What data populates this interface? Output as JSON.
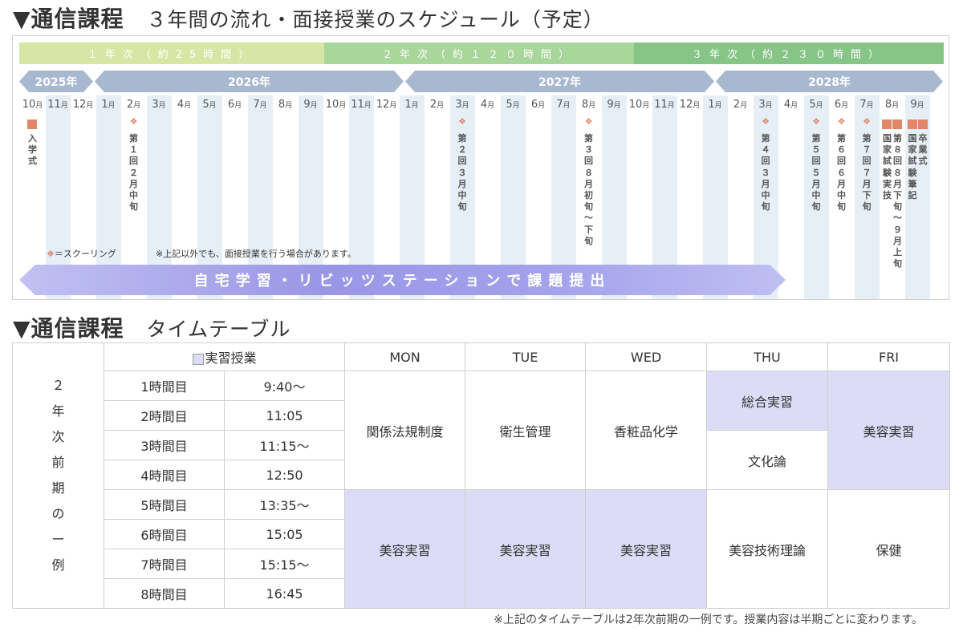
{
  "schedule_title": {
    "main": "▼通信課程",
    "sub": "３年間の流れ・面接授業のスケジュール（予定）"
  },
  "year_bars": [
    {
      "label": "１年次（約25時間）",
      "color": "#d7e6a4"
    },
    {
      "label": "２年次（約１２０時間）",
      "color": "#a9d69a"
    },
    {
      "label": "３年次（約２３０時間）",
      "color": "#86c585"
    }
  ],
  "calendar_years": [
    "2025年",
    "2026年",
    "2027年",
    "2028年"
  ],
  "months": [
    "10月",
    "11月",
    "12月",
    "1月",
    "2月",
    "3月",
    "4月",
    "5月",
    "6月",
    "7月",
    "8月",
    "9月",
    "10月",
    "11月",
    "12月",
    "1月",
    "2月",
    "3月",
    "4月",
    "5月",
    "6月",
    "7月",
    "8月",
    "9月",
    "10月",
    "11月",
    "12月",
    "1月",
    "2月",
    "3月",
    "4月",
    "5月",
    "6月",
    "7月",
    "8月",
    "9月"
  ],
  "events": [
    {
      "text": "入学式",
      "col": 0,
      "type": "square"
    },
    {
      "text": "第１回２月中旬",
      "col": 4,
      "type": "schooling"
    },
    {
      "text": "第２回３月中旬",
      "col": 17,
      "type": "schooling"
    },
    {
      "text": "第３回８月初旬〜下旬",
      "col": 22,
      "type": "schooling"
    },
    {
      "text": "第４回３月中旬",
      "col": 29,
      "type": "schooling"
    },
    {
      "text": "第５回５月中旬",
      "col": 31,
      "type": "schooling"
    },
    {
      "text": "第６回６月中旬",
      "col": 32,
      "type": "schooling"
    },
    {
      "text": "第７回７月下旬",
      "col": 33,
      "type": "schooling"
    },
    {
      "text": "国家試験実技",
      "col": 34,
      "type": "square",
      "shift": -6
    },
    {
      "text": "第８回８月下旬〜９月上旬",
      "col": 34,
      "type": "square",
      "shift": 7
    },
    {
      "text": "国家試験筆記",
      "col": 35,
      "type": "square",
      "shift": -6
    },
    {
      "text": "卒業式",
      "col": 35,
      "type": "square",
      "shift": 7
    }
  ],
  "legend_schooling": "＝スクーリング",
  "note_other": "※上記以外でも、面接授業を行う場合があります。",
  "study_band": "自宅学習・リビッツステーションで課題提出",
  "timetable_title": {
    "main": "▼通信課程",
    "sub": "タイムテーブル"
  },
  "timetable": {
    "legend": "実習授業",
    "side_label": [
      "２",
      "年",
      "次",
      "前",
      "期",
      "の",
      "ー",
      "例"
    ],
    "days": [
      "MON",
      "TUE",
      "WED",
      "THU",
      "FRI"
    ],
    "periods": [
      "1時間目",
      "2時間目",
      "3時間目",
      "4時間目",
      "5時間目",
      "6時間目",
      "7時間目",
      "8時間目"
    ],
    "times": [
      "9:40〜",
      "11:05",
      "11:15〜",
      "12:50",
      "13:35〜",
      "15:05",
      "15:15〜",
      "16:45"
    ],
    "morning": {
      "mon": "関係法規制度",
      "tue": "衛生管理",
      "wed": "香粧品化学",
      "thu_1": "総合実習",
      "thu_2": "文化論",
      "fri": "美容実習"
    },
    "afternoon": {
      "mon": "美容実習",
      "tue": "美容実習",
      "wed": "美容実習",
      "thu": "美容技術理論",
      "fri": "保健"
    },
    "practical_color": "#dcdcf7"
  },
  "footnote": "※上記のタイムテーブルは2年次前期の一例です。授業内容は半期ごとに変わります。"
}
